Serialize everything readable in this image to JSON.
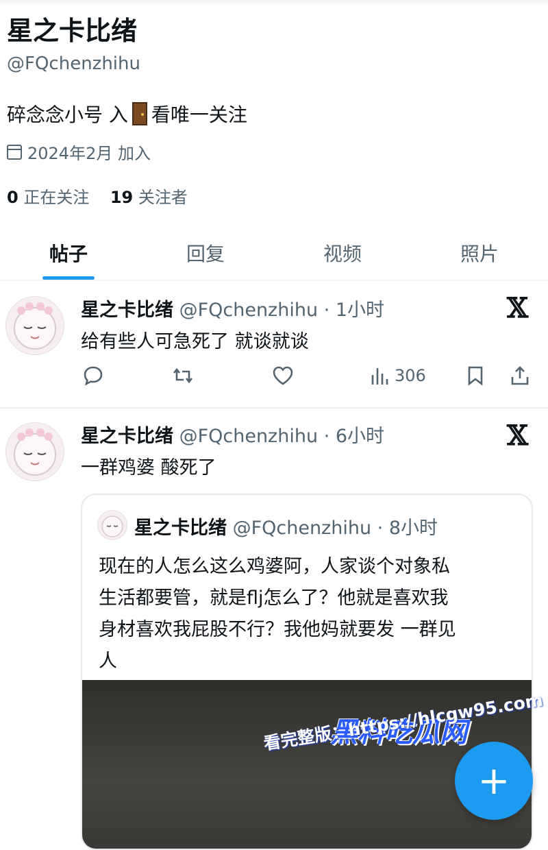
{
  "profile": {
    "display_name": "星之卡比绪",
    "handle": "@FQchenzhihu",
    "bio_before": "碎念念小号 入",
    "bio_after": "看唯一关注",
    "bio_icon": "door-icon",
    "joined": "2024年2月 加入",
    "following_count": "0",
    "following_label": "正在关注",
    "followers_count": "19",
    "followers_label": "关注者"
  },
  "tabs": [
    {
      "label": "帖子",
      "active": true
    },
    {
      "label": "回复",
      "active": false
    },
    {
      "label": "视频",
      "active": false
    },
    {
      "label": "照片",
      "active": false
    }
  ],
  "posts": [
    {
      "name": "星之卡比绪",
      "handle_time": "@FQchenzhihu · 1小时",
      "text": "给有些人可急死了 就谈就谈",
      "views": "306"
    },
    {
      "name": "星之卡比绪",
      "handle_time": "@FQchenzhihu · 6小时",
      "text": "一群鸡婆 酸死了",
      "quote": {
        "name": "星之卡比绪",
        "handle_time": "@FQchenzhihu · 8小时",
        "lines": [
          "现在的人怎么这么鸡婆阿，人家谈个对象私",
          "生活都要管，就是flj怎么了？他就是喜欢我",
          "身材喜欢我屁股不行？我他妈就要发 一群见",
          "人"
        ]
      }
    }
  ],
  "watermark": {
    "site": "黑料吃瓜网",
    "line": "看完整版：https://hlcgw95.com"
  },
  "fab_label": "+",
  "colors": {
    "accent": "#1d9bf0",
    "secondary_text": "#536471",
    "divider": "#eff3f4"
  }
}
